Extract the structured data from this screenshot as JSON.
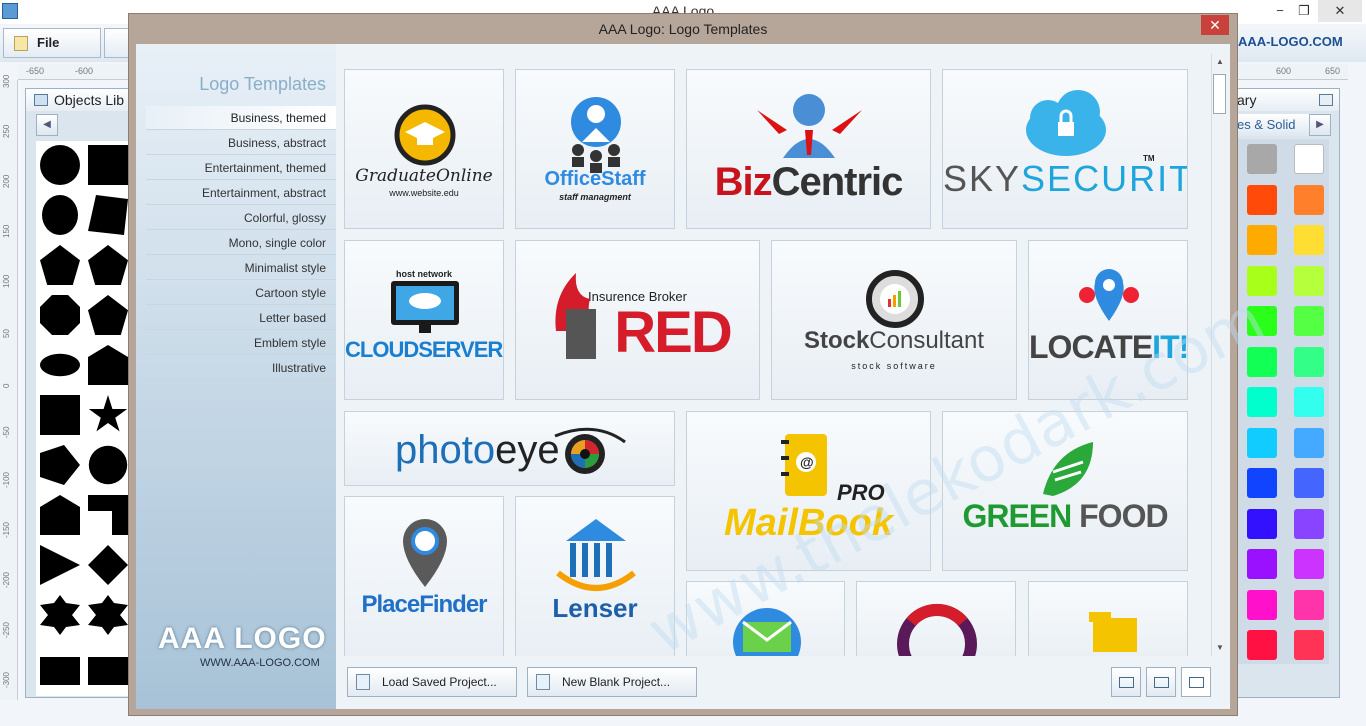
{
  "app": {
    "title": "AAA Logo",
    "brand_url": "AAA-LOGO.COM",
    "file_label": "File",
    "window_controls": [
      "−",
      "❐",
      "✕"
    ]
  },
  "rulers": {
    "top_left": [
      "-650",
      "-600"
    ],
    "top_right": [
      "600",
      "650"
    ],
    "left": [
      "300",
      "250",
      "200",
      "150",
      "100",
      "50",
      "0",
      "-50",
      "-100",
      "-150",
      "-200",
      "-250",
      "-300"
    ]
  },
  "objects_panel": {
    "title": "Objects Lib"
  },
  "right_panel": {
    "title": "ary",
    "tab": "es & Solid",
    "colors": [
      "#a8a8a8",
      "#ffffff",
      "#ff4a0a",
      "#ff7f2a",
      "#ffaa00",
      "#ffdd33",
      "#a8ff1a",
      "#b6ff3c",
      "#2aff1a",
      "#55ff44",
      "#12ff55",
      "#33ff88",
      "#00ffcc",
      "#33ffee",
      "#11ccff",
      "#44aaff",
      "#1144ff",
      "#4466ff",
      "#3311ff",
      "#8844ff",
      "#9911ff",
      "#cc33ff",
      "#ff11cc",
      "#ff33aa",
      "#ff1144",
      "#ff3355"
    ]
  },
  "dialog": {
    "title": "AAA Logo: Logo Templates",
    "close": "✕",
    "sidebar_heading": "Logo Templates",
    "categories": [
      "Business, themed",
      "Business, abstract",
      "Entertainment, themed",
      "Entertainment, abstract",
      "Colorful, glossy",
      "Mono, single color",
      "Minimalist style",
      "Cartoon style",
      "Letter based",
      "Emblem style",
      "Illustrative"
    ],
    "active_category": "Business, themed",
    "brand_logo": "AAA LOGO",
    "brand_url": "WWW.AAA-LOGO.COM",
    "load_button": "Load Saved Project...",
    "new_button": "New Blank Project..."
  },
  "templates": {
    "graduate": {
      "name": "GraduateOnline",
      "tagline": "www.website.edu"
    },
    "officestaff": {
      "name": "OfficeStaff",
      "tagline": "staff managment"
    },
    "bizcentric": {
      "name_a": "Biz",
      "name_b": "Centric"
    },
    "skysecurity": {
      "name_a": "SKY",
      "name_b": "SECURITY",
      "tm": "TM"
    },
    "cloudservers": {
      "tag": "host network",
      "name": "CLOUDSERVERS"
    },
    "red": {
      "tag": "Insurence Broker",
      "name": "RED"
    },
    "stock": {
      "name_a": "Stock",
      "name_b": "Consultant",
      "tagline": "stock software"
    },
    "locateit": {
      "name_a": "LOCATE",
      "name_b": "IT!"
    },
    "photoeye": {
      "name_a": "photo",
      "name_b": "eye"
    },
    "mailbook": {
      "pro": "PRO",
      "name": "MailBook"
    },
    "greenfood": {
      "name_a": "GREEN",
      "name_b": "FOOD"
    },
    "placefinder": {
      "name": "PlaceFinder"
    },
    "lenser": {
      "name": "Lenser"
    }
  },
  "watermark": "www.thelekodark.com"
}
